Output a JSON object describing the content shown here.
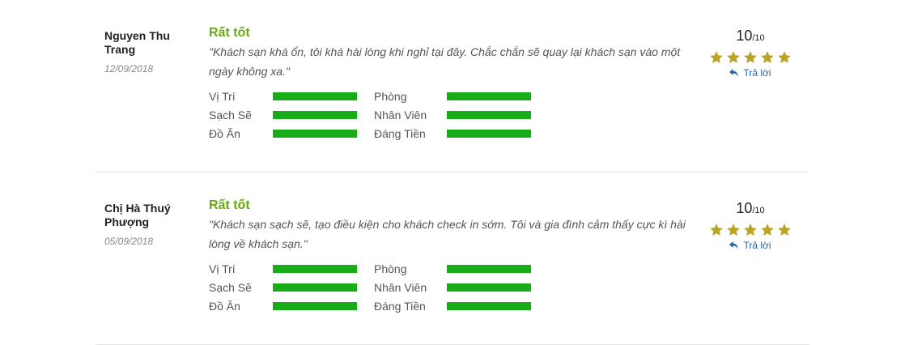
{
  "colors": {
    "verdict": "#6aa716",
    "bar": "#18ad18",
    "star": "#b9a425",
    "link": "#2a5fa8"
  },
  "icons": {
    "star": "star-icon",
    "reply": "reply-arrow-icon"
  },
  "reviews": [
    {
      "author": "Nguyen Thu Trang",
      "date": "12/09/2018",
      "verdict": "Rất tốt",
      "comment": "\"Khách sạn khá ổn, tôi khá hài lòng khi nghỉ tại đây. Chắc chắn sẽ quay lại khách sạn vào một ngày không xa.\"",
      "score": "10",
      "score_max": "/10",
      "stars": 5,
      "reply": "Trả lời",
      "categories": [
        {
          "label": "Vị Trí",
          "fill": 1.0
        },
        {
          "label": "Phòng",
          "fill": 1.0
        },
        {
          "label": "Sạch Sẽ",
          "fill": 1.0
        },
        {
          "label": "Nhân Viên",
          "fill": 1.0
        },
        {
          "label": "Đồ Ăn",
          "fill": 1.0
        },
        {
          "label": "Đáng Tiền",
          "fill": 1.0
        }
      ]
    },
    {
      "author": "Chị Hà Thuý Phượng",
      "date": "05/09/2018",
      "verdict": "Rất tốt",
      "comment": "\"Khách sạn sạch sẽ, tạo điều kiện cho khách check in sớm. Tôi và gia đình cảm thấy cực kì hài lòng về khách sạn.\"",
      "score": "10",
      "score_max": "/10",
      "stars": 5,
      "reply": "Trả lời",
      "categories": [
        {
          "label": "Vị Trí",
          "fill": 1.0
        },
        {
          "label": "Phòng",
          "fill": 1.0
        },
        {
          "label": "Sạch Sẽ",
          "fill": 1.0
        },
        {
          "label": "Nhân Viên",
          "fill": 1.0
        },
        {
          "label": "Đồ Ăn",
          "fill": 1.0
        },
        {
          "label": "Đáng Tiền",
          "fill": 1.0
        }
      ]
    }
  ]
}
